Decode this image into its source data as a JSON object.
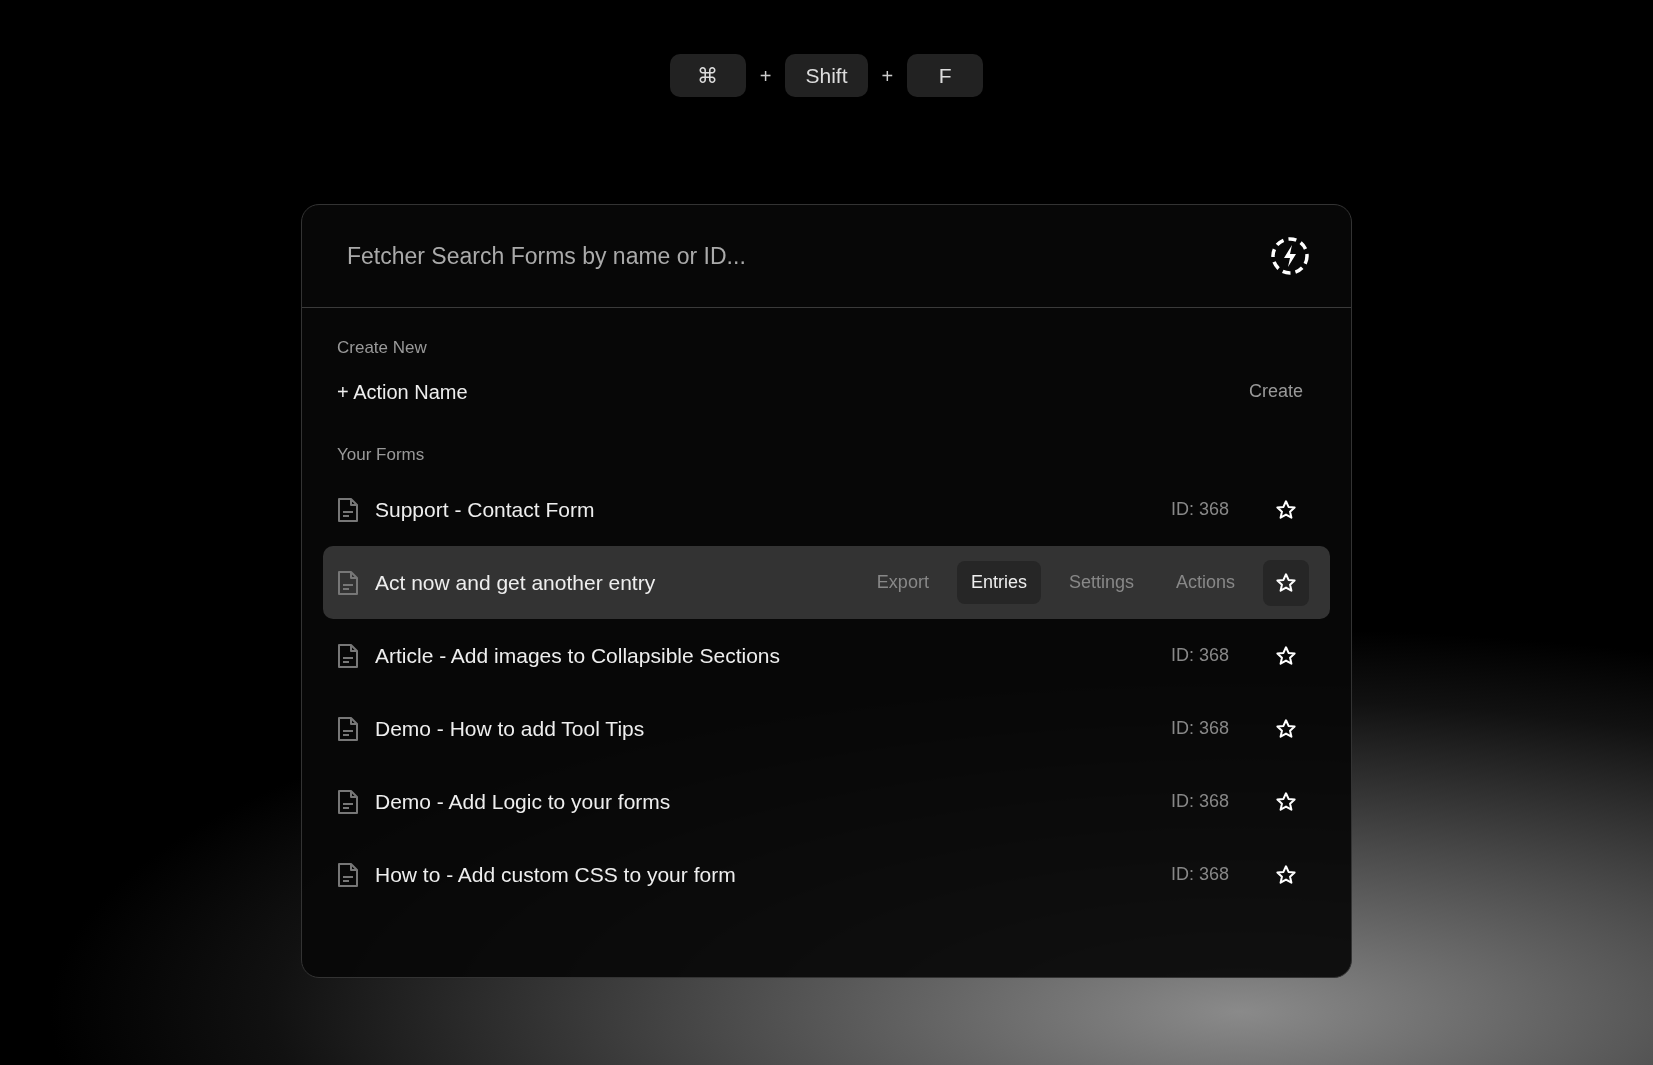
{
  "shortcut": {
    "keys": [
      "⌘",
      "Shift",
      "F"
    ],
    "separator": "+"
  },
  "search": {
    "placeholder": "Fetcher Search Forms by name or ID..."
  },
  "create_section": {
    "title": "Create New",
    "item": "+ Action Name",
    "action": "Create"
  },
  "forms_section": {
    "title": "Your Forms",
    "forms": [
      {
        "name": "Support - Contact Form",
        "id": "ID: 368",
        "selected": false
      },
      {
        "name": "Act now and get another entry",
        "selected": true,
        "actions": [
          {
            "label": "Export",
            "selected": false
          },
          {
            "label": "Entries",
            "selected": true
          },
          {
            "label": "Settings",
            "selected": false
          },
          {
            "label": "Actions",
            "selected": false
          }
        ]
      },
      {
        "name": "Article - Add images to Collapsible Sections",
        "id": "ID: 368",
        "selected": false
      },
      {
        "name": "Demo - How to add Tool Tips",
        "id": "ID: 368",
        "selected": false
      },
      {
        "name": "Demo - Add Logic to your forms",
        "id": "ID: 368",
        "selected": false
      },
      {
        "name": "How to - Add custom CSS to your form",
        "id": "ID: 368",
        "selected": false
      }
    ]
  }
}
